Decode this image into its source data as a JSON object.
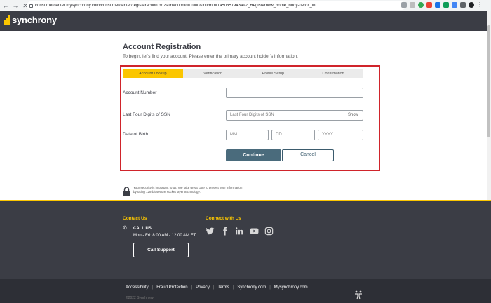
{
  "browser": {
    "url": "consumercenter.mysynchrony.com/consumercenter/registeraction.do?subActionId=1000&intcmp=1450357943492_Registernow_home_body-herox_int",
    "nav_back": "←",
    "nav_forward": "→",
    "nav_reload": "✕"
  },
  "header": {
    "logo_text": "synchrony"
  },
  "main": {
    "title": "Account Registration",
    "intro": "To begin, let's find your account. Please enter the primary account holder's information.",
    "steps": [
      {
        "label": "Account Lookup",
        "active": true
      },
      {
        "label": "Verification",
        "active": false
      },
      {
        "label": "Profile Setup",
        "active": false
      },
      {
        "label": "Confirmation",
        "active": false
      }
    ],
    "fields": {
      "account_number": {
        "label": "Account Number",
        "value": "",
        "placeholder": ""
      },
      "ssn": {
        "label": "Last Four Digits of SSN",
        "placeholder": "Last Four Digits of SSN",
        "show_label": "Show"
      },
      "dob": {
        "label": "Date of Birth",
        "mm": "MM",
        "dd": "DD",
        "yyyy": "YYYY"
      }
    },
    "continue_label": "Continue",
    "cancel_label": "Cancel",
    "security_text": "Your security is important to us. We take great care to protect your information by using 128-bit secure socket layer technology."
  },
  "footer": {
    "contact_title": "Contact Us",
    "connect_title": "Connect with Us",
    "call_us": "CALL US",
    "hours": "Mon - Fri: 8:00 AM - 12:00 AM ET",
    "call_support_label": "Call Support",
    "social": [
      "twitter-icon",
      "facebook-icon",
      "linkedin-icon",
      "youtube-icon",
      "instagram-icon"
    ],
    "links": [
      "Accessibility",
      "Fraud Protection",
      "Privacy",
      "Terms",
      "Synchrony.com",
      "Mysynchrony.com"
    ],
    "copyright": "©2022 Synchrony"
  },
  "colors": {
    "brand_yellow": "#fbc600",
    "header_dark": "#3b3d45",
    "highlight_red": "#d0242b",
    "button_blue": "#4a6b7c"
  }
}
